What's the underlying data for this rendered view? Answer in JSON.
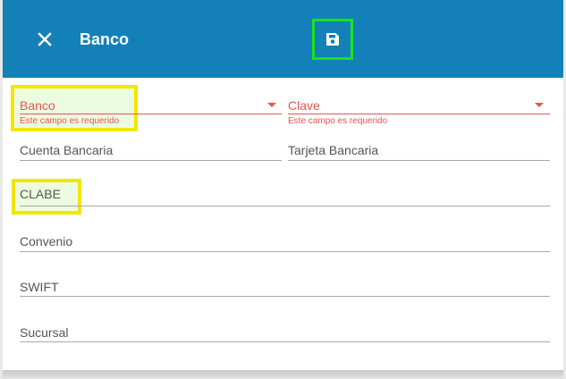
{
  "header": {
    "title": "Banco",
    "close_icon": "close-icon",
    "save_icon": "save-icon",
    "background": "#1480b8"
  },
  "form": {
    "banco": {
      "label": "Banco",
      "error": "Este campo es requerido"
    },
    "clave": {
      "label": "Clave",
      "error": "Este campo es requerido"
    },
    "cuenta_bancaria": {
      "label": "Cuenta Bancaria"
    },
    "tarjeta_bancaria": {
      "label": "Tarjeta Bancaria"
    },
    "clabe": {
      "label": "CLABE"
    },
    "convenio": {
      "label": "Convenio"
    },
    "swift": {
      "label": "SWIFT"
    },
    "sucursal": {
      "label": "Sucursal"
    }
  },
  "colors": {
    "error": "#e8544f",
    "highlight_yellow": "#f2e600",
    "highlight_green": "#18e418"
  }
}
